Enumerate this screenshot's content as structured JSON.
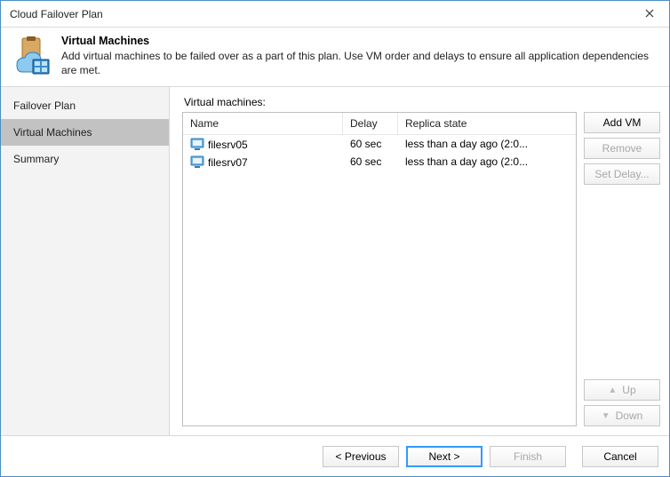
{
  "window": {
    "title": "Cloud Failover Plan"
  },
  "header": {
    "title": "Virtual Machines",
    "description": "Add virtual machines to be failed over as a part of this plan. Use VM order and delays to ensure all application dependencies are met."
  },
  "sidebar": {
    "items": [
      {
        "label": "Failover Plan",
        "selected": false
      },
      {
        "label": "Virtual Machines",
        "selected": true
      },
      {
        "label": "Summary",
        "selected": false
      }
    ]
  },
  "main": {
    "list_label": "Virtual machines:",
    "columns": {
      "name": "Name",
      "delay": "Delay",
      "state": "Replica state"
    },
    "rows": [
      {
        "name": "filesrv05",
        "delay": "60 sec",
        "state": "less than a day ago (2:0..."
      },
      {
        "name": "filesrv07",
        "delay": "60 sec",
        "state": "less than a day ago (2:0..."
      }
    ]
  },
  "rbuttons": {
    "add": "Add VM",
    "remove": "Remove",
    "setdelay": "Set Delay...",
    "up": "Up",
    "down": "Down"
  },
  "footer": {
    "previous": "< Previous",
    "next": "Next >",
    "finish": "Finish",
    "cancel": "Cancel"
  }
}
